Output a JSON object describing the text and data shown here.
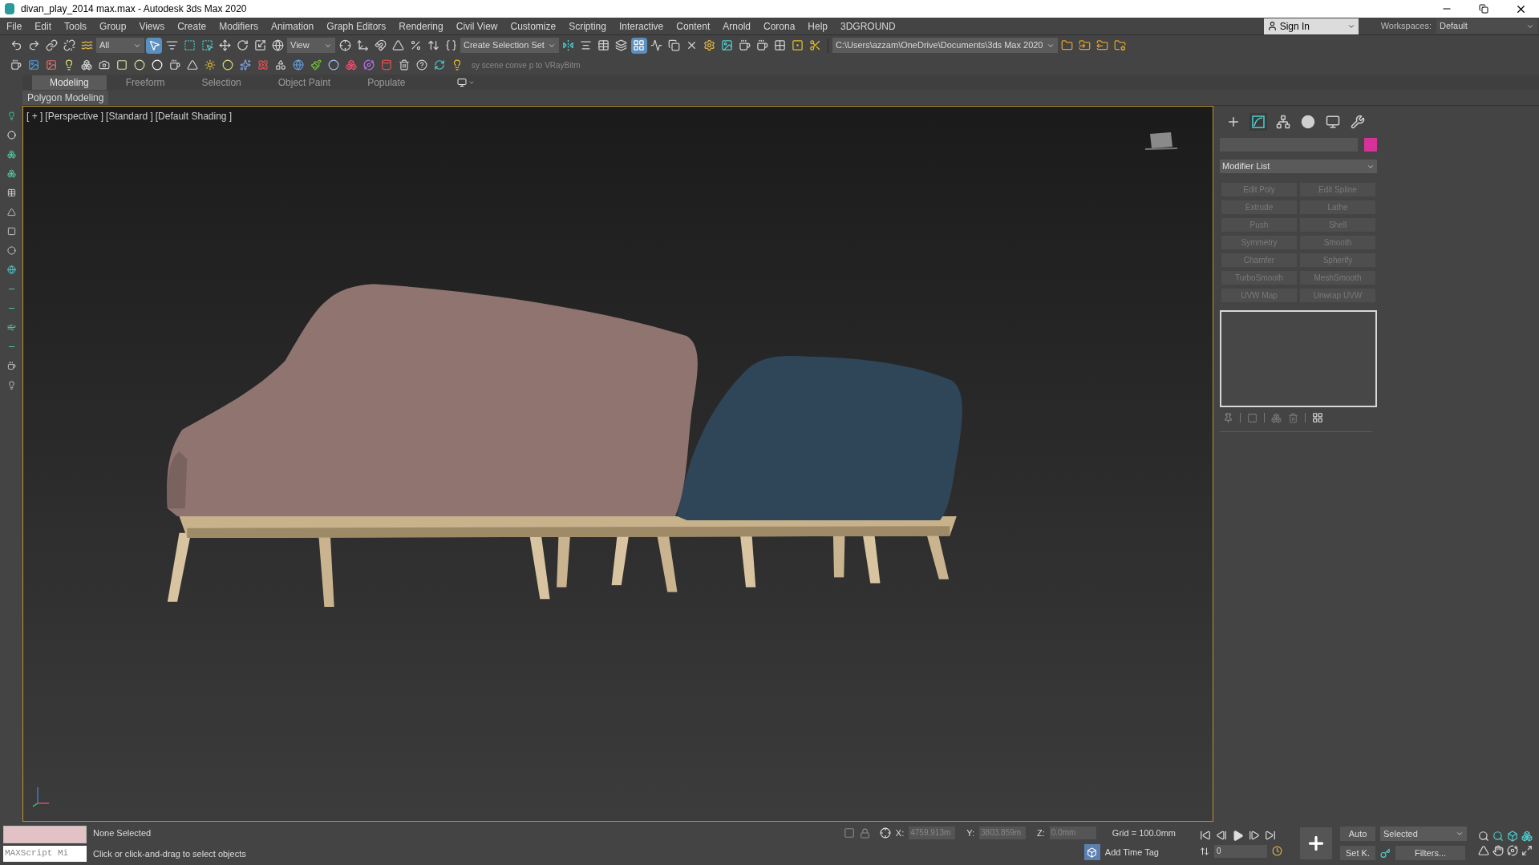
{
  "window": {
    "title": "divan_play_2014 max.max - Autodesk 3ds Max 2020"
  },
  "menu": [
    "File",
    "Edit",
    "Tools",
    "Group",
    "Views",
    "Create",
    "Modifiers",
    "Animation",
    "Graph Editors",
    "Rendering",
    "Civil View",
    "Customize",
    "Scripting",
    "Interactive",
    "Content",
    "Arnold",
    "Corona",
    "Help",
    "3DGROUND"
  ],
  "account": {
    "label": "Sign In"
  },
  "workspaces": {
    "label": "Workspaces:",
    "value": "Default"
  },
  "main_toolbar": {
    "selection_filter": "All",
    "reference_coord": "View",
    "selection_set": "Create Selection Set",
    "project_path": "C:\\Users\\azzam\\OneDrive\\Documents\\3ds Max 2020"
  },
  "secondary_toolbar": {
    "script_hint": "sy scene conve p to VRayBitm"
  },
  "ribbon": {
    "tabs": [
      {
        "label": "Modeling",
        "selected": true
      },
      {
        "label": "Freeform",
        "selected": false
      },
      {
        "label": "Selection",
        "selected": false
      },
      {
        "label": "Object Paint",
        "selected": false
      },
      {
        "label": "Populate",
        "selected": false
      }
    ],
    "panel": "Polygon Modeling"
  },
  "viewport": {
    "labels": [
      "[ + ]",
      "[Perspective ]",
      "[Standard ]",
      "[Default Shading ]"
    ]
  },
  "command_panel": {
    "tabs": [
      {
        "kind": "create",
        "selected": false
      },
      {
        "kind": "modify",
        "selected": true
      },
      {
        "kind": "hierarchy",
        "selected": false
      },
      {
        "kind": "motion",
        "selected": false
      },
      {
        "kind": "display",
        "selected": false
      },
      {
        "kind": "utilities",
        "selected": false
      }
    ],
    "object": {
      "color": "#d6339a"
    },
    "modifier_list": "Modifier List",
    "modifier_buttons": [
      {
        "label": "Edit Poly",
        "disabled": true
      },
      {
        "label": "Edit Spline",
        "disabled": true
      },
      {
        "label": "Extrude",
        "disabled": true
      },
      {
        "label": "Lathe",
        "disabled": true
      },
      {
        "label": "Push",
        "disabled": true
      },
      {
        "label": "Shell",
        "disabled": true
      },
      {
        "label": "Symmetry",
        "disabled": true
      },
      {
        "label": "Smooth",
        "disabled": true
      },
      {
        "label": "Chamfer",
        "disabled": true
      },
      {
        "label": "Spherify",
        "disabled": true
      },
      {
        "label": "TurboSmooth",
        "disabled": true
      },
      {
        "label": "MeshSmooth",
        "disabled": true
      },
      {
        "label": "UVW Map",
        "disabled": true
      },
      {
        "label": "Unwrap UVW",
        "disabled": true
      }
    ]
  },
  "status": {
    "listener": "MAXScript Mi",
    "selection": "None Selected",
    "prompt": "Click or click-and-drag to select objects",
    "x_label": "X:",
    "x": "4759.913m",
    "y_label": "Y:",
    "y": "3803.859m",
    "z_label": "Z:",
    "z": "0.0mm",
    "grid": "Grid = 100.0mm",
    "time_tag": "Add Time Tag",
    "frame": "0",
    "auto_key": "Auto",
    "set_key": "Set K.",
    "key_filter": "Selected",
    "filters": "Filters..."
  }
}
